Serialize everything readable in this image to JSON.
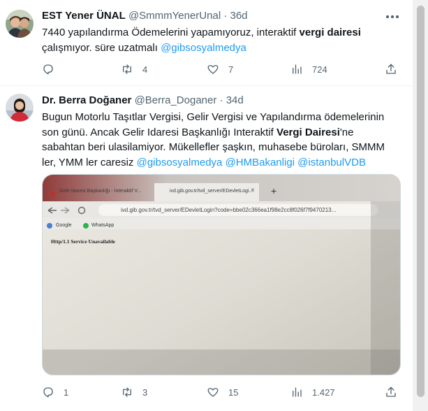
{
  "tweets": [
    {
      "author_name": "EST Yener ÜNAL",
      "handle": "@SmmmYenerUnal",
      "separator": "·",
      "age": "36d",
      "text_plain_1": "7440 yapılandırma Ödemelerini yapamıyoruz, interaktif ",
      "text_bold_1": "vergi dairesi",
      "text_plain_2": "çalışmıyor. süre uzatmalı ",
      "mention_1": "@gibsosyalmedya",
      "replies": "",
      "retweets": "4",
      "likes": "7",
      "views": "724"
    },
    {
      "author_name": "Dr. Berra Doğaner",
      "handle": "@Berra_Doganer",
      "separator": "·",
      "age": "34d",
      "line_1": "Bugun Motorlu Taşıtlar Vergisi, Gelir Vergisi ve Yapılandırma ödemelerinin",
      "line_2a": "son günü. Ancak Gelir Idaresi Başkanlığı Interaktif ",
      "line_2b": "Vergi Dairesi",
      "line_2c": "'ne",
      "line_3": "sabahtan beri ulasilamiyor. Mükellefler şaşkın, muhasebe büroları, SMMM",
      "line_4a": "ler, YMM ler caresiz  ",
      "mention_1": "@gibsosyalmedya",
      "mention_2": "@HMBakanligi",
      "mention_3": "@istanbulVDB",
      "replies": "1",
      "retweets": "3",
      "likes": "15",
      "views": "1.427"
    }
  ],
  "photo": {
    "tab_1": "Gelir Idaresi Başkanlığı - İnteraktif V...",
    "tab_2": "ivd.gib.gov.tr/tvd_server/EDevletLogi...",
    "tab_close": "×",
    "new_tab": "+",
    "address": "ivd.gib.gov.tr/tvd_server/EDevletLogin?code=bbe02c366ea1f98e2cc8f026f7f9470213...",
    "bookmark_1": "Google",
    "bookmark_2": "WhatsApp",
    "page_message": "Http/1.1 Service Unavailable"
  },
  "colors": {
    "link": "#1d9bf0",
    "muted": "#536471",
    "text": "#0f1419"
  }
}
